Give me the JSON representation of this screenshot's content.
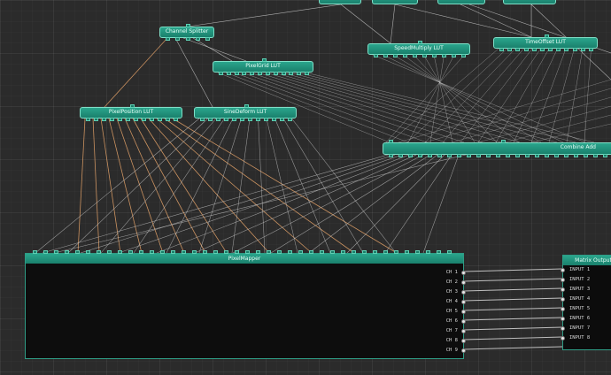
{
  "nodes": {
    "top_stub_1": "",
    "top_stub_2": "",
    "top_stub_3": "",
    "top_stub_4": "",
    "channel_splitter": "Channel Splitter",
    "pixel_grid_lut": "PixelGrid LUT",
    "pixel_position_lut": "PixelPosition LUT",
    "sine_deform_lut": "SineDeform LUT",
    "speed_multiply_lut": "SpeedMultiply LUT",
    "time_offset_lut": "TimeOffset LUT",
    "combine_add": "Combine Add",
    "pixel_mapper": "PixelMapper",
    "matrix_output": "Matrix Output"
  },
  "pixel_mapper_outputs": [
    "CH 1",
    "CH 2",
    "CH 3",
    "CH 4",
    "CH 5",
    "CH 6",
    "CH 7",
    "CH 8",
    "CH 9"
  ],
  "matrix_inputs": [
    "INPUT 1",
    "INPUT 2",
    "INPUT 3",
    "INPUT 4",
    "INPUT 5",
    "INPUT 6",
    "INPUT 7",
    "INPUT 8"
  ],
  "colors": {
    "node_fill": "#23977f",
    "wire_white": "#cfcfcf",
    "wire_orange": "#e8a56a",
    "background": "#2b2b2b"
  }
}
